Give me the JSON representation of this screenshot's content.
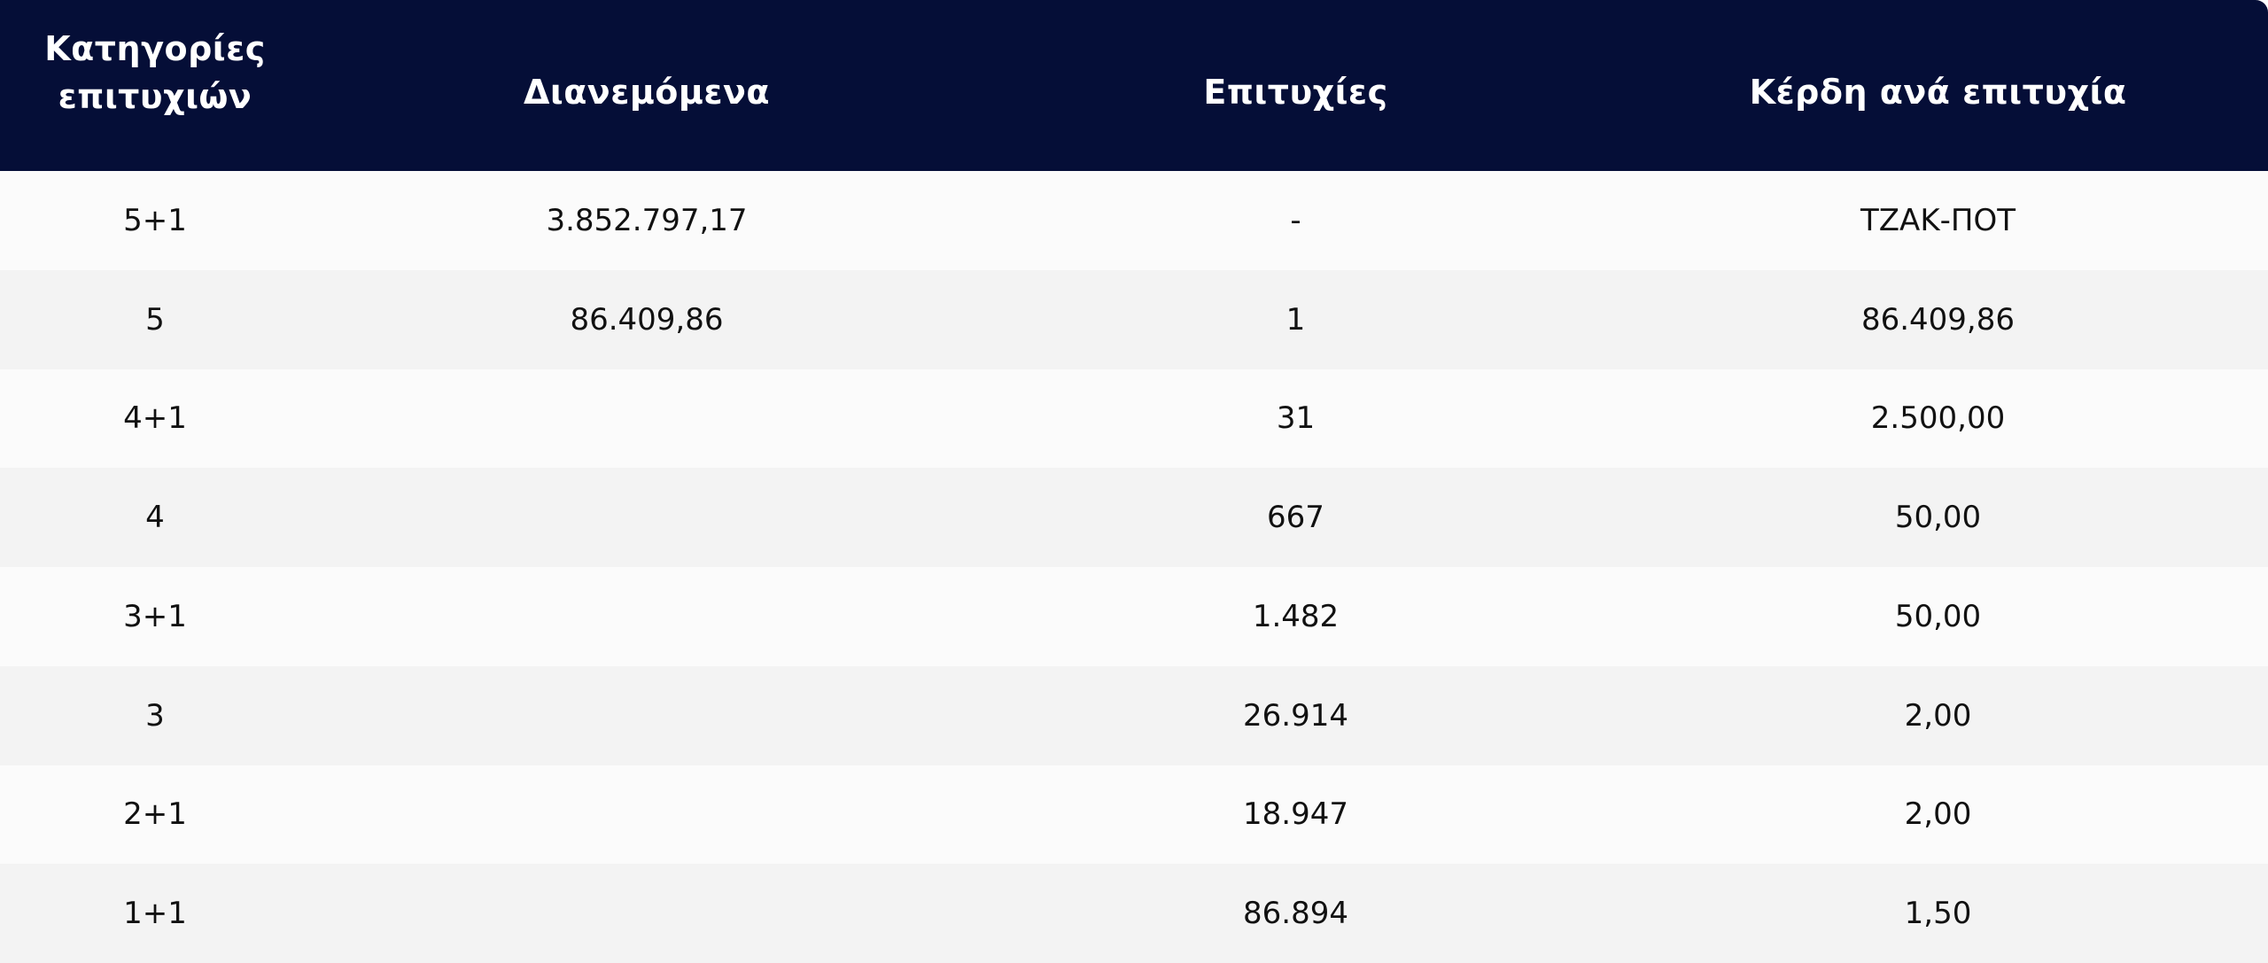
{
  "table": {
    "headers": {
      "category_line1": "Κατηγορίες",
      "category_line2": "επιτυχιών",
      "distributed": "Διανεμόμενα",
      "winners": "Επιτυχίες",
      "prize_per_winner": "Κέρδη ανά επιτυχία"
    },
    "rows": [
      {
        "category": "5+1",
        "distributed": "3.852.797,17",
        "winners": "-",
        "prize": "ΤΖΑΚ-ΠΟΤ"
      },
      {
        "category": "5",
        "distributed": "86.409,86",
        "winners": "1",
        "prize": "86.409,86"
      },
      {
        "category": "4+1",
        "distributed": "",
        "winners": "31",
        "prize": "2.500,00"
      },
      {
        "category": "4",
        "distributed": "",
        "winners": "667",
        "prize": "50,00"
      },
      {
        "category": "3+1",
        "distributed": "",
        "winners": "1.482",
        "prize": "50,00"
      },
      {
        "category": "3",
        "distributed": "",
        "winners": "26.914",
        "prize": "2,00"
      },
      {
        "category": "2+1",
        "distributed": "",
        "winners": "18.947",
        "prize": "2,00"
      },
      {
        "category": "1+1",
        "distributed": "",
        "winners": "86.894",
        "prize": "1,50"
      }
    ]
  },
  "colors": {
    "header_background": "#050e37",
    "header_text": "#ffffff",
    "row_odd": "#fbfbfb",
    "row_even": "#f3f3f3"
  }
}
